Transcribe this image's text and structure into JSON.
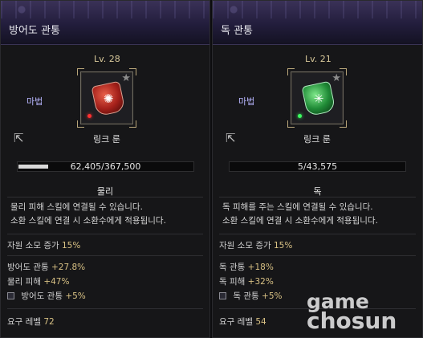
{
  "left": {
    "title": "방어도 관통",
    "level": "Lv. 28",
    "type": "마법",
    "rune_label": "링크 룬",
    "progress_text": "62,405/367,500",
    "progress_fraction": 0.17,
    "element": "물리",
    "description": "물리 피해 스킬에 연결될 수 있습니다.\n소환 스킬에 연결 시 소환수에게 적용됩니다.",
    "cost_label": "자원 소모 증가",
    "cost_value": "15%",
    "stats": [
      {
        "label": "방어도 관통",
        "value": "+27.8%"
      },
      {
        "label": "물리 피해",
        "value": "+47%"
      }
    ],
    "bonus": {
      "label": "방어도 관통",
      "value": "+5%"
    },
    "req_label": "요구 레벨",
    "req_value": "72",
    "gem_color": "#b32a1f",
    "icon": "shield-rune-icon"
  },
  "right": {
    "title": "독 관통",
    "level": "Lv. 21",
    "type": "마법",
    "rune_label": "링크 룬",
    "progress_text": "5/43,575",
    "progress_fraction": 0.0,
    "element": "독",
    "description": "독 피해를 주는 스킬에 연결될 수 있습니다.\n소환 스킬에 연결 시 소환수에게 적용됩니다.",
    "cost_label": "자원 소모 증가",
    "cost_value": "15%",
    "stats": [
      {
        "label": "독 관통",
        "value": "+18%"
      },
      {
        "label": "독 피해",
        "value": "+32%"
      }
    ],
    "bonus": {
      "label": "독 관통",
      "value": "+5%"
    },
    "req_label": "요구 레벨",
    "req_value": "54",
    "gem_color": "#1f8a36",
    "icon": "dice-rune-icon"
  },
  "watermark": {
    "line1": "game",
    "line2": "chosun"
  }
}
